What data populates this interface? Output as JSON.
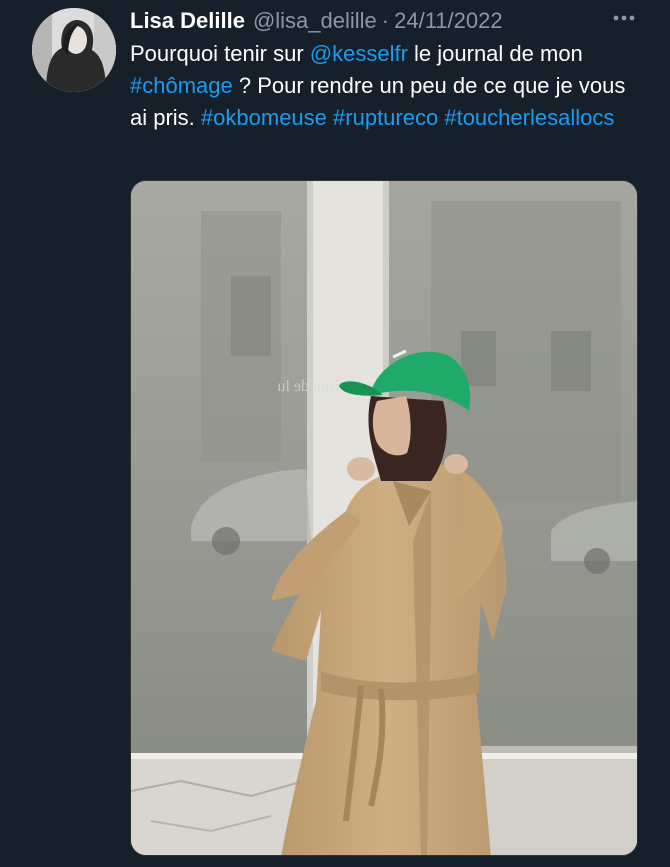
{
  "author": {
    "display_name": "Lisa Delille",
    "handle": "@lisa_delille",
    "separator": "·",
    "date": "24/11/2022"
  },
  "tweet": {
    "text_1": "Pourquoi tenir sur ",
    "mention": "@kesselfr",
    "text_2": " le journal de mon ",
    "hashtag_1": "#chômage",
    "text_3": " ? Pour rendre un peu de ce que je vous ai pris. ",
    "hashtag_2": "#okbomeuse",
    "hashtag_3": "#ruptureco",
    "hashtag_4": "#toucherlesallocs"
  },
  "media": {
    "window_sign_text": "Maison de lu"
  },
  "icons": {
    "more": "more-horizontal-icon"
  },
  "colors": {
    "background": "#15202b",
    "link": "#1d9bf0",
    "secondary_text": "#8b98a5",
    "cap_green": "#1faa6a",
    "coat_beige": "#c8a87c"
  }
}
